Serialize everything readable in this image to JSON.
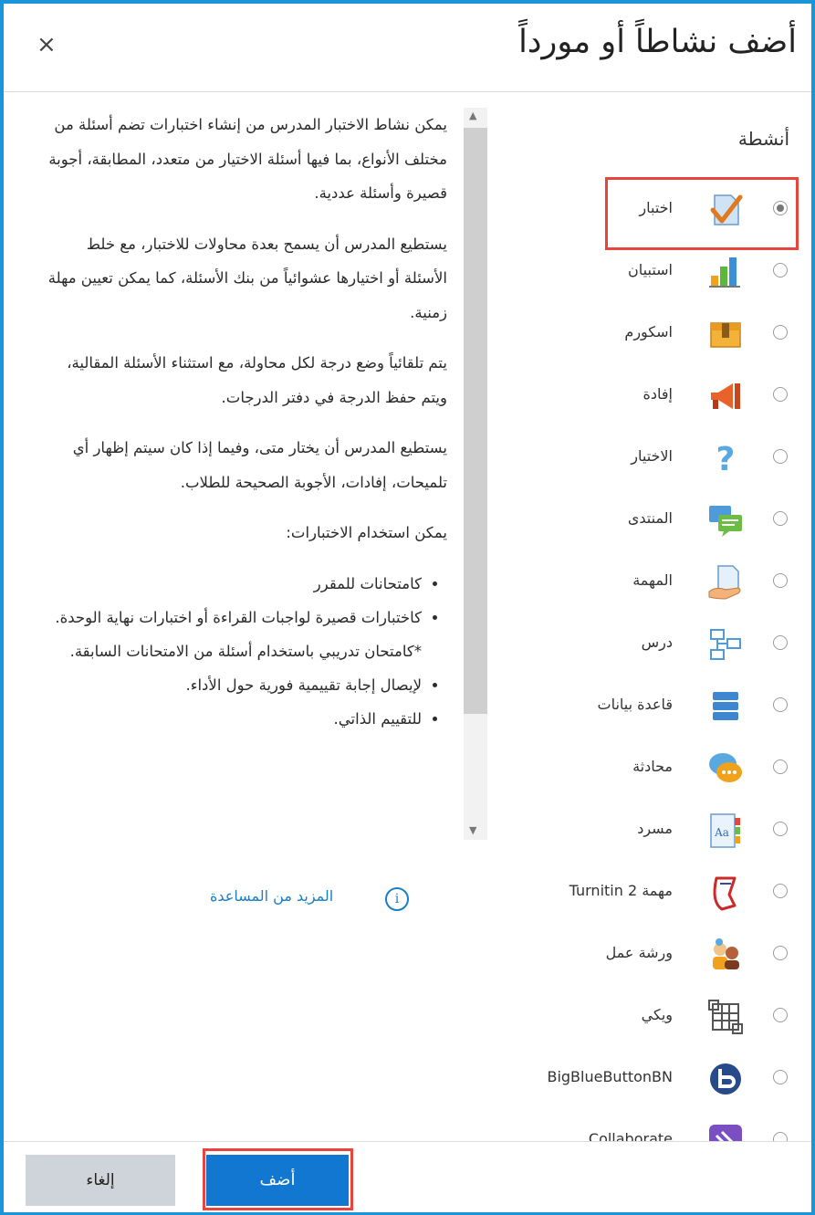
{
  "dialog": {
    "title": "أضف نشاطاً أو مورداً",
    "close_symbol": "×"
  },
  "list": {
    "section_header": "أنشطة",
    "items": [
      {
        "label": "اختبار",
        "selected": true,
        "icon": "quiz-icon"
      },
      {
        "label": "استبيان",
        "selected": false,
        "icon": "feedback-chart-icon"
      },
      {
        "label": "اسكورم",
        "selected": false,
        "icon": "scorm-package-icon"
      },
      {
        "label": "إفادة",
        "selected": false,
        "icon": "megaphone-icon"
      },
      {
        "label": "الاختيار",
        "selected": false,
        "icon": "question-mark-icon"
      },
      {
        "label": "المنتدى",
        "selected": false,
        "icon": "forum-icon"
      },
      {
        "label": "المهمة",
        "selected": false,
        "icon": "assignment-hand-icon"
      },
      {
        "label": "درس",
        "selected": false,
        "icon": "lesson-icon"
      },
      {
        "label": "قاعدة بيانات",
        "selected": false,
        "icon": "database-icon"
      },
      {
        "label": "محادثة",
        "selected": false,
        "icon": "chat-icon"
      },
      {
        "label": "مسرد",
        "selected": false,
        "icon": "glossary-icon"
      },
      {
        "label": "مهمة Turnitin 2",
        "selected": false,
        "icon": "turnitin-icon"
      },
      {
        "label": "ورشة عمل",
        "selected": false,
        "icon": "workshop-icon"
      },
      {
        "label": "ويكي",
        "selected": false,
        "icon": "wiki-icon"
      },
      {
        "label": "BigBlueButtonBN",
        "selected": false,
        "icon": "bigbluebutton-icon"
      },
      {
        "label": "Collaborate",
        "selected": false,
        "icon": "collaborate-icon"
      }
    ]
  },
  "description": {
    "paragraphs": [
      "يمكن نشاط الاختبار المدرس من إنشاء اختبارات تضم أسئلة من مختلف الأنواع، بما فيها أسئلة الاختيار من متعدد، المطابقة، أجوبة قصيرة وأسئلة عددية.",
      "يستطيع المدرس أن يسمح بعدة محاولات للاختبار، مع خلط الأسئلة أو اختيارها عشوائياً من بنك الأسئلة، كما يمكن تعيين مهلة زمنية.",
      "يتم تلقائياً وضع درجة لكل محاولة، مع استثناء الأسئلة المقالية، ويتم حفظ الدرجة في دفتر الدرجات.",
      "يستطيع المدرس أن يختار متى، وفيما إذا كان سيتم إظهار أي تلميحات، إفادات، الأجوبة الصحيحة للطلاب.",
      "يمكن استخدام الاختبارات:"
    ],
    "bullets": [
      "كامتحانات للمقرر",
      "كاختبارات قصيرة لواجبات القراءة أو اختبارات نهاية الوحدة. *كامتحان تدريبي باستخدام أسئلة من الامتحانات السابقة.",
      "لإيصال إجابة تقييمية فورية حول الأداء.",
      "للتقييم الذاتي."
    ],
    "help_link": "المزيد من المساعدة"
  },
  "footer": {
    "add_label": "أضف",
    "cancel_label": "إلغاء"
  },
  "colors": {
    "frame_border": "#1a95d8",
    "highlight": "#e8453c",
    "primary_button": "#1177d1",
    "link": "#1a7fc4"
  }
}
